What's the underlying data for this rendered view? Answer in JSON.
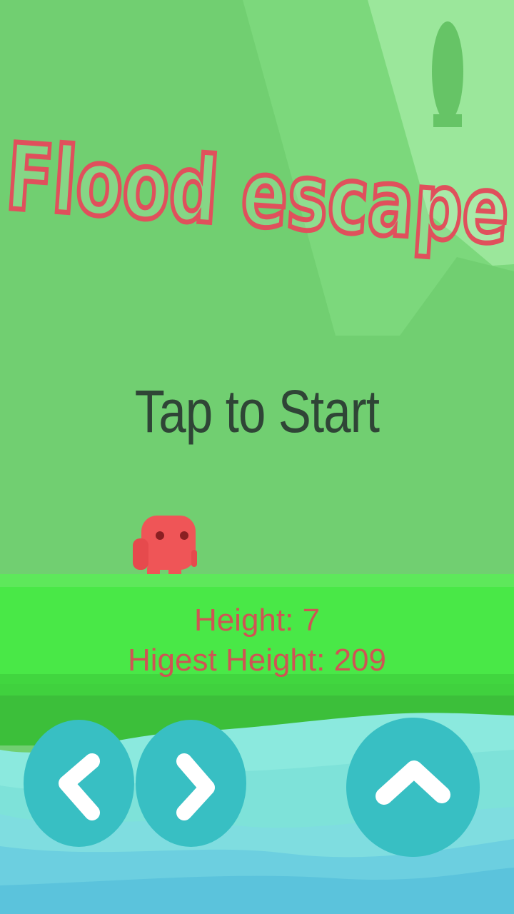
{
  "game": {
    "title": "Flood escape",
    "prompt": "Tap to Start",
    "hud": {
      "height_text": "Height: 7",
      "highest_text": "Higest Height: 209"
    },
    "controls": {
      "left_icon": "chevron-left-icon",
      "right_icon": "chevron-right-icon",
      "jump_icon": "chevron-up-icon"
    },
    "colors": {
      "background": "#71cf71",
      "title": "#e0505c",
      "prompt_text": "#2f4536",
      "hud_text": "#cf5454",
      "player": "#ef5557",
      "platform": "#49e847",
      "water": "#8be9de",
      "button": "#38bfc3"
    }
  }
}
